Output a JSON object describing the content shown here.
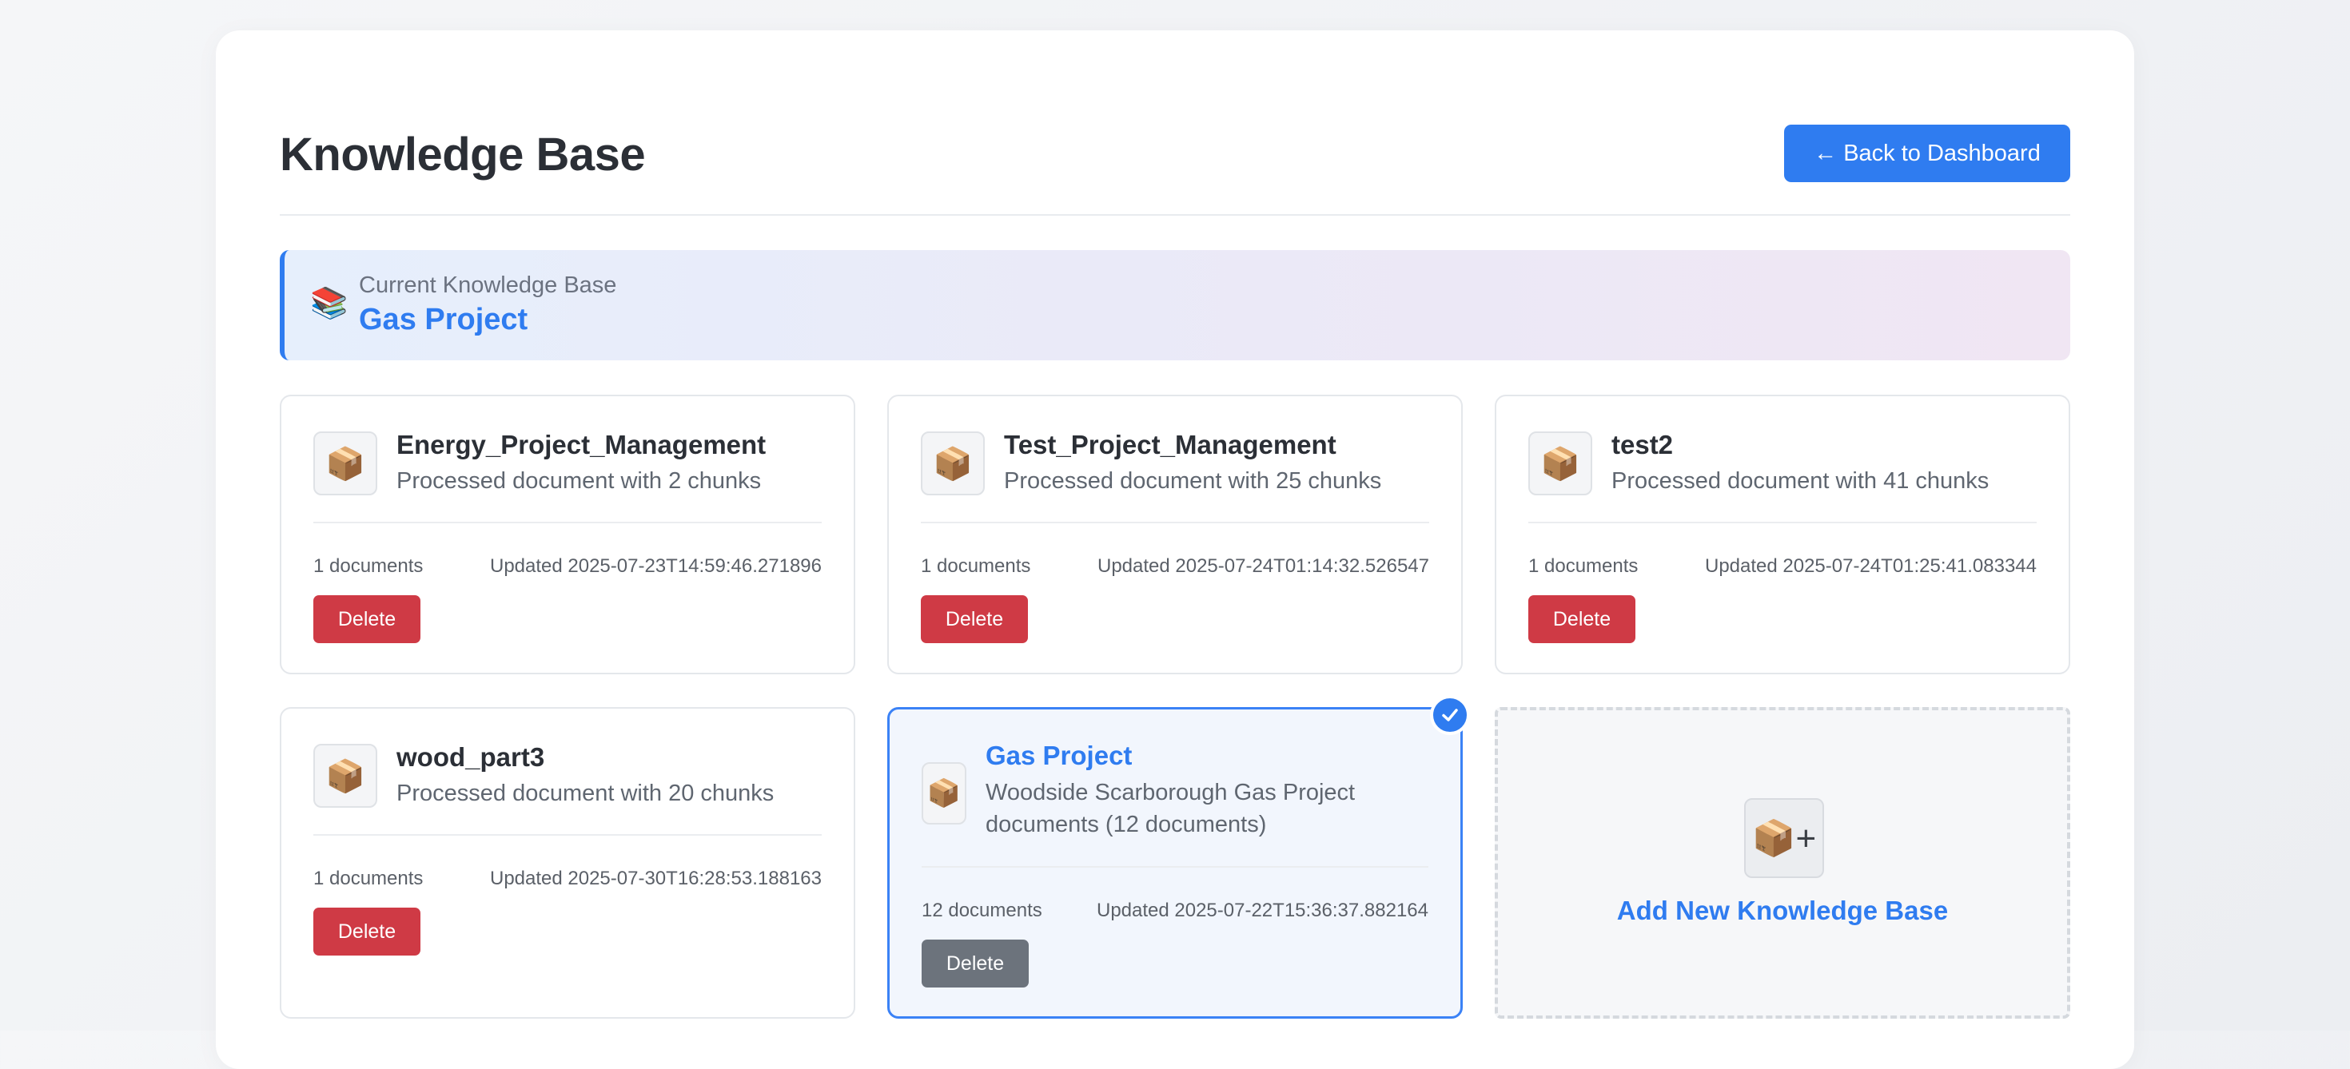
{
  "page": {
    "title": "Knowledge Base",
    "back_button": "← Back to Dashboard"
  },
  "current_kb": {
    "icon": "books-icon",
    "icon_glyph": "📚",
    "label": "Current Knowledge Base",
    "name": "Gas Project"
  },
  "kb_cards": [
    {
      "name": "Energy_Project_Management",
      "description": "Processed document with 2 chunks",
      "documents": "1 documents",
      "updated": "Updated 2025-07-23T14:59:46.271896",
      "delete_label": "Delete",
      "active": false
    },
    {
      "name": "Test_Project_Management",
      "description": "Processed document with 25 chunks",
      "documents": "1 documents",
      "updated": "Updated 2025-07-24T01:14:32.526547",
      "delete_label": "Delete",
      "active": false
    },
    {
      "name": "test2",
      "description": "Processed document with 41 chunks",
      "documents": "1 documents",
      "updated": "Updated 2025-07-24T01:25:41.083344",
      "delete_label": "Delete",
      "active": false
    },
    {
      "name": "wood_part3",
      "description": "Processed document with 20 chunks",
      "documents": "1 documents",
      "updated": "Updated 2025-07-30T16:28:53.188163",
      "delete_label": "Delete",
      "active": false
    },
    {
      "name": "Gas Project",
      "description": "Woodside Scarborough Gas Project documents (12 documents)",
      "documents": "12 documents",
      "updated": "Updated 2025-07-22T15:36:37.882164",
      "delete_label": "Delete",
      "active": true
    }
  ],
  "add_card": {
    "icon": "package-plus-icon",
    "icon_glyph": "📦+",
    "label": "Add New Knowledge Base"
  },
  "icons": {
    "kb_card_icon": "package-icon",
    "kb_card_glyph": "📦",
    "active_badge": "checkmark-icon"
  },
  "colors": {
    "accent": "#2f7cf0",
    "delete": "#cf3a45",
    "delete_active": "#6c737c"
  }
}
